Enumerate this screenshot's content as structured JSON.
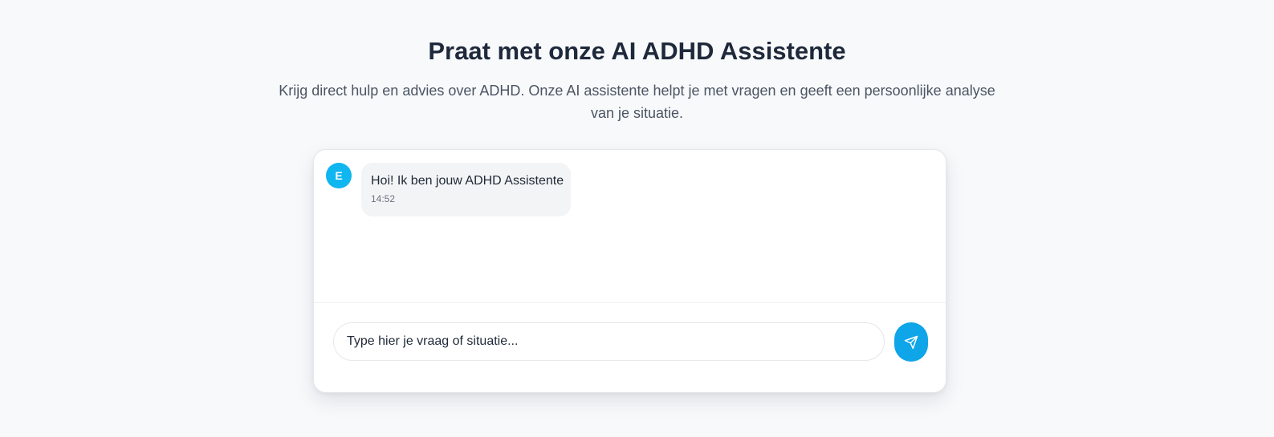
{
  "header": {
    "title": "Praat met onze AI ADHD Assistente",
    "subtitle": "Krijg direct hulp en advies over ADHD. Onze AI assistente helpt je met vragen en geeft een persoonlijke analyse van je situatie."
  },
  "chat": {
    "messages": [
      {
        "avatar_initial": "E",
        "text": "Hoi! Ik ben jouw ADHD Assistente",
        "time": "14:52"
      }
    ],
    "input": {
      "placeholder": "Type hier je vraag of situatie..."
    },
    "send_icon": "send-icon"
  },
  "colors": {
    "accent": "#0ea5e9",
    "avatar": "#0fb6f0",
    "bubble": "#f3f4f6",
    "background": "#f8f9fb"
  }
}
